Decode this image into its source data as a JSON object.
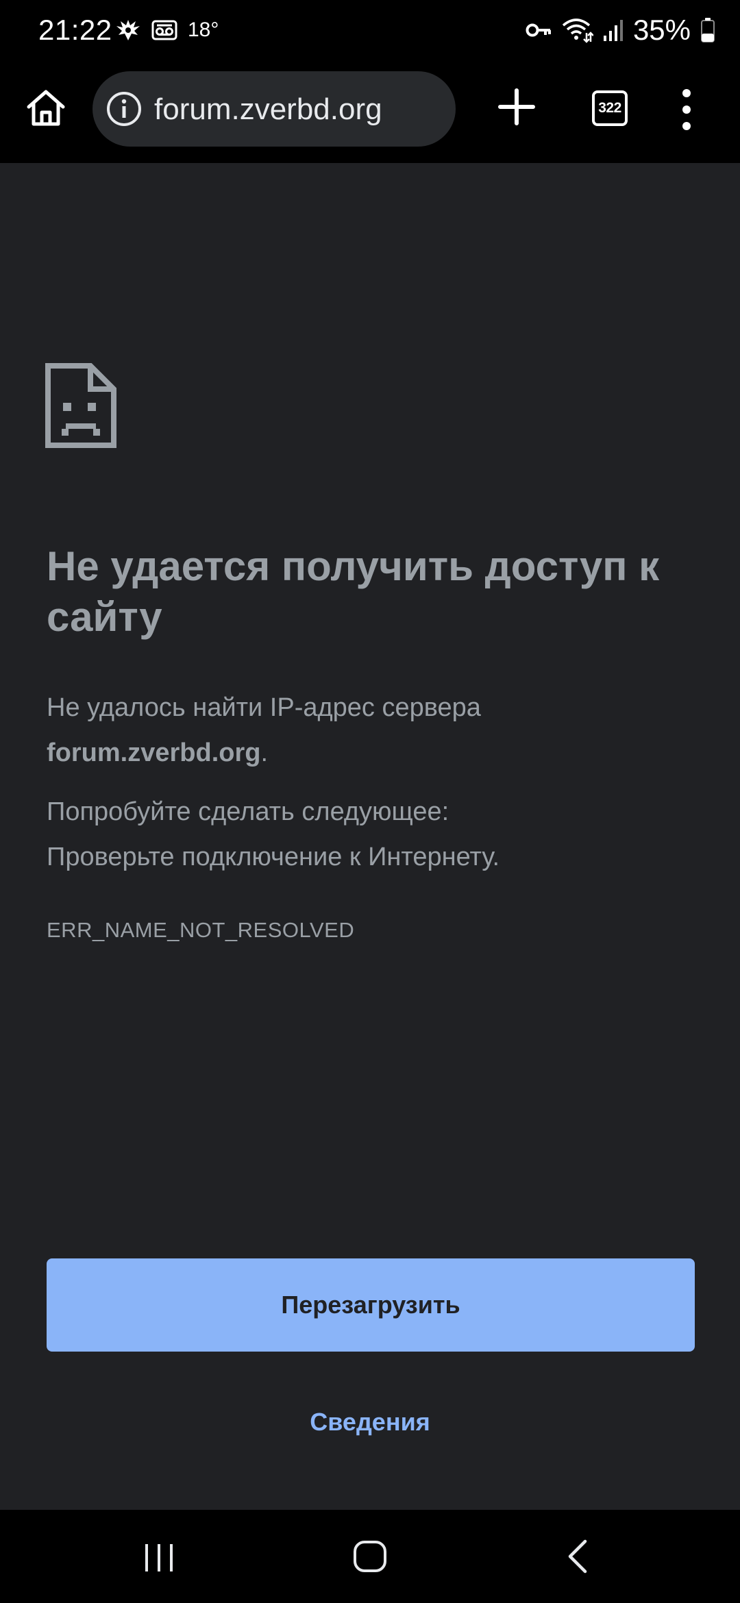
{
  "status_bar": {
    "time": "21:22",
    "temperature": "18°",
    "battery": "35%"
  },
  "toolbar": {
    "url": "forum.zverbd.org",
    "tab_count": "322"
  },
  "error_page": {
    "title": "Не удается получить доступ к сайту",
    "description_prefix": "Не удалось найти IP-адрес сервера",
    "host": "forum.zverbd.org",
    "description_suffix": ".",
    "suggestion_heading": "Попробуйте сделать следующее:",
    "suggestion_item": "Проверьте подключение к Интернету.",
    "error_code": "ERR_NAME_NOT_RESOLVED",
    "reload_label": "Перезагрузить",
    "details_label": "Сведения"
  },
  "colors": {
    "background": "#202124",
    "text_muted": "#9aa0a6",
    "accent": "#8ab4f8",
    "omnibox": "#282a2d"
  },
  "icons": {
    "home": "home-icon",
    "info": "info-icon",
    "new_tab": "plus-icon",
    "tabs": "tab-switcher-icon",
    "menu": "more-vert-icon",
    "sad_page": "sad-page-icon",
    "nav_recents": "recents-icon",
    "nav_home": "nav-home-icon",
    "nav_back": "back-icon"
  }
}
